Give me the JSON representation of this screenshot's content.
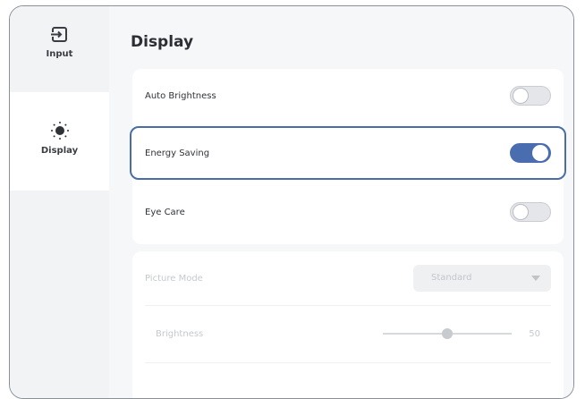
{
  "sidebar": {
    "items": [
      {
        "label": "Input",
        "icon": "input-icon",
        "selected": false
      },
      {
        "label": "Display",
        "icon": "brightness-icon",
        "selected": true
      }
    ]
  },
  "page": {
    "title": "Display"
  },
  "settings": {
    "auto_brightness": {
      "label": "Auto Brightness",
      "on": false
    },
    "energy_saving": {
      "label": "Energy Saving",
      "on": true
    },
    "eye_care": {
      "label": "Eye Care",
      "on": false
    }
  },
  "picture": {
    "mode_label": "Picture Mode",
    "mode_value": "Standard",
    "brightness_label": "Brightness",
    "brightness_value": "50"
  },
  "colors": {
    "accent": "#4a6db0",
    "selected_border": "#4a6da7"
  }
}
